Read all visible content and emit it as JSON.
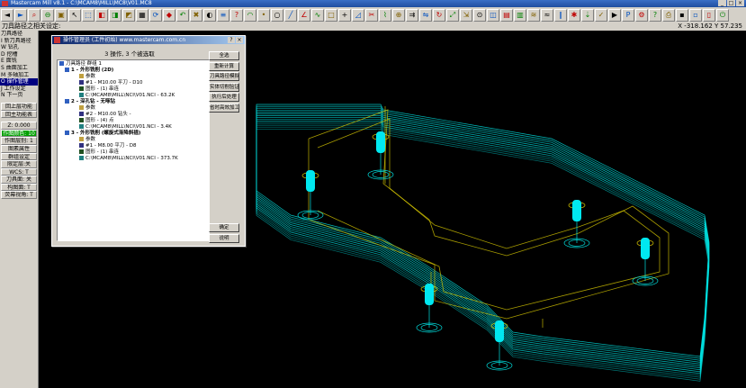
{
  "window": {
    "title": "Mastercam Mill v8.1 - C:\\MCAM8\\MILL\\MC8\\V01.MC8",
    "buttons": [
      "_",
      "□",
      "×"
    ]
  },
  "toolbar": {
    "icons": [
      "arrow-left-icon",
      "arrow-right-icon",
      "zoom-icon",
      "zoom-out-icon",
      "fit-icon",
      "select-icon",
      "cube-iso-icon",
      "cube-top-icon",
      "cube-front-icon",
      "cube-side-icon",
      "cube-view-icon",
      "cube-rotate-icon",
      "cube-shade-icon",
      "undo-icon",
      "delete-icon",
      "color-icon",
      "layer-icon",
      "analyze-icon",
      "arc-icon",
      "point-icon",
      "circle-icon",
      "line-icon",
      "line-angle-icon",
      "curve-icon",
      "rect-icon",
      "plus-icon",
      "chamfer-icon",
      "trim-icon",
      "break-icon",
      "join-icon",
      "offset-icon",
      "mirror-icon",
      "rotate-icon",
      "scale-icon",
      "translate-icon",
      "drill-icon",
      "contour-icon",
      "pocket-icon",
      "face-icon",
      "surface-icon",
      "flowline-icon",
      "parallel-icon",
      "radial-icon",
      "project-icon",
      "verify-icon",
      "backplot-icon",
      "post-icon",
      "settings-icon",
      "help-icon",
      "print-icon",
      "save-icon",
      "open-icon",
      "new-icon",
      "exit-icon"
    ]
  },
  "prompt": {
    "text": "刀具路径之相关设定:",
    "coords": "X -318.162  Y 57.235"
  },
  "leftmenu": {
    "items": [
      "刀具路径",
      "I 新刀具路径",
      "W 钻孔",
      "D 挖槽",
      "E 面铣",
      "S 曲面加工",
      "M 多轴加工",
      "O 操作管理",
      "J 工作设定",
      "N 下一页"
    ],
    "selected_index": 7,
    "nav": [
      "回上层功能",
      "回主功能表"
    ],
    "status": [
      "Z: 0.000",
      "作图颜色: 10",
      "作图层别: 1",
      "图素属性",
      "群组设定",
      "限定层:关",
      "WCS: T",
      "刀具面: 关",
      "构图面: T",
      "荧幕视角: T"
    ],
    "highlight_index": 1
  },
  "dialog": {
    "title": "操作管理员 (工件初始) www.mastercam.com.cn",
    "help_btn": "?",
    "close_btn": "×",
    "summary": "3 操作, 3 个被选取",
    "tree": {
      "root": "刀具路径 群组 1",
      "ops": [
        {
          "title": "1 - 外形铣削 (2D)",
          "params": "参数",
          "tool": "#1 - M10.00 平刀 - D10",
          "geom": "图形 - (1) 串连",
          "nci": "C:\\MCAM8\\MILL\\NCI\\V01.NCI - 63.2K"
        },
        {
          "title": "2 - 深孔钻 - 无啄钻",
          "params": "参数",
          "tool": "#2 - M10.00 钻头 -",
          "geom": "图形 - (4) 点",
          "nci": "C:\\MCAM8\\MILL\\NCI\\V01.NCI - 3.4K"
        },
        {
          "title": "3 - 外形铣削 (螺旋式渐降斜插)",
          "params": "参数",
          "tool": "#1 - M8.00 平刀 - D8",
          "geom": "图形 - (1) 串连",
          "nci": "C:\\MCAM8\\MILL\\NCI\\V01.NCI - 373.7K"
        }
      ]
    },
    "buttons": [
      "全选",
      "重新计算",
      "刀具路径模拟",
      "实体切削验证",
      "执行后处理",
      "省时高效加工"
    ],
    "bottom_buttons": [
      "确定",
      "说明"
    ]
  },
  "colors": {
    "wire": "#00e0e0",
    "toolpath": "#e0d000",
    "tool": "#00e8f0",
    "menu_sel": "#000080",
    "status_hl": "#00a000"
  }
}
